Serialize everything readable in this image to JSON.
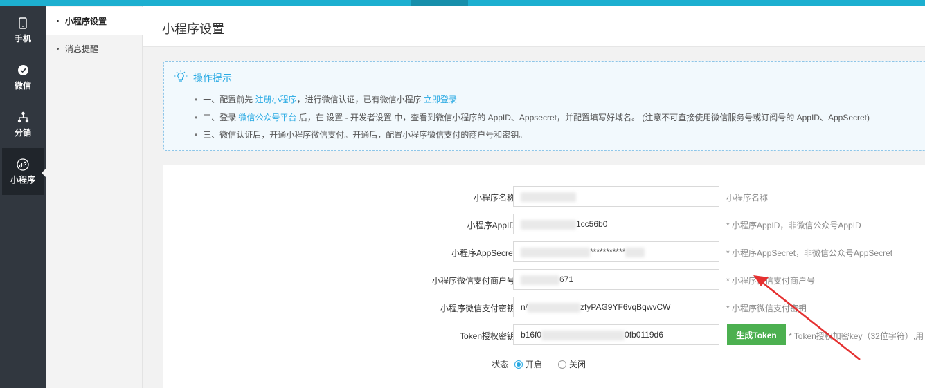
{
  "nav": [
    {
      "icon": "phone-icon",
      "label": "手机"
    },
    {
      "icon": "wechat-icon",
      "label": "微信"
    },
    {
      "icon": "distribution-icon",
      "label": "分销"
    },
    {
      "icon": "mini-program-icon",
      "label": "小程序"
    }
  ],
  "subnav": [
    {
      "label": "小程序设置"
    },
    {
      "label": "消息提醒"
    }
  ],
  "page": {
    "title": "小程序设置"
  },
  "tips": {
    "title": "操作提示",
    "line1": {
      "pre": "一、配置前先 ",
      "link1": "注册小程序",
      "mid": "，进行微信认证，已有微信小程序 ",
      "link2": "立即登录"
    },
    "line2": {
      "pre": "二、登录 ",
      "link1": "微信公众号平台",
      "post": " 后，在 设置 - 开发者设置 中，查看到微信小程序的 AppID、Appsecret，并配置填写好域名。 (注意不可直接使用微信服务号或订阅号的 AppID、AppSecret)"
    },
    "line3": "三、微信认证后，开通小程序微信支付。开通后，配置小程序微信支付的商户号和密钥。"
  },
  "form": {
    "name": {
      "label": "小程序名称",
      "value": "",
      "hint": "小程序名称"
    },
    "appid": {
      "label": "小程序AppID",
      "value": "1cc56b0",
      "hint": "* 小程序AppID，非微信公众号AppID"
    },
    "secret": {
      "label": "小程序AppSecret",
      "value": "***********",
      "hint": "* 小程序AppSecret，非微信公众号AppSecret"
    },
    "mchid": {
      "label": "小程序微信支付商户号",
      "value": "671",
      "hint": "* 小程序微信支付商户号"
    },
    "paykey": {
      "label": "小程序微信支付密钥",
      "value_pre": "n/",
      "value": "zfyPAG9YF6vqBqwvCW",
      "hint": "* 小程序微信支付密钥"
    },
    "token": {
      "label": "Token授权密钥",
      "value_pre": "b16f0",
      "value": "0fb0119d6",
      "button": "生成Token",
      "hint": "* Token授权加密key（32位字符）,用"
    },
    "status": {
      "label": "状态",
      "on": "开启",
      "off": "关闭",
      "selected": "开启"
    }
  },
  "colors": {
    "accent": "#27a9e3",
    "button": "#4cb050",
    "sidebar": "#31373f",
    "topbar": "#1dafd0",
    "annotation": "#e53030"
  }
}
